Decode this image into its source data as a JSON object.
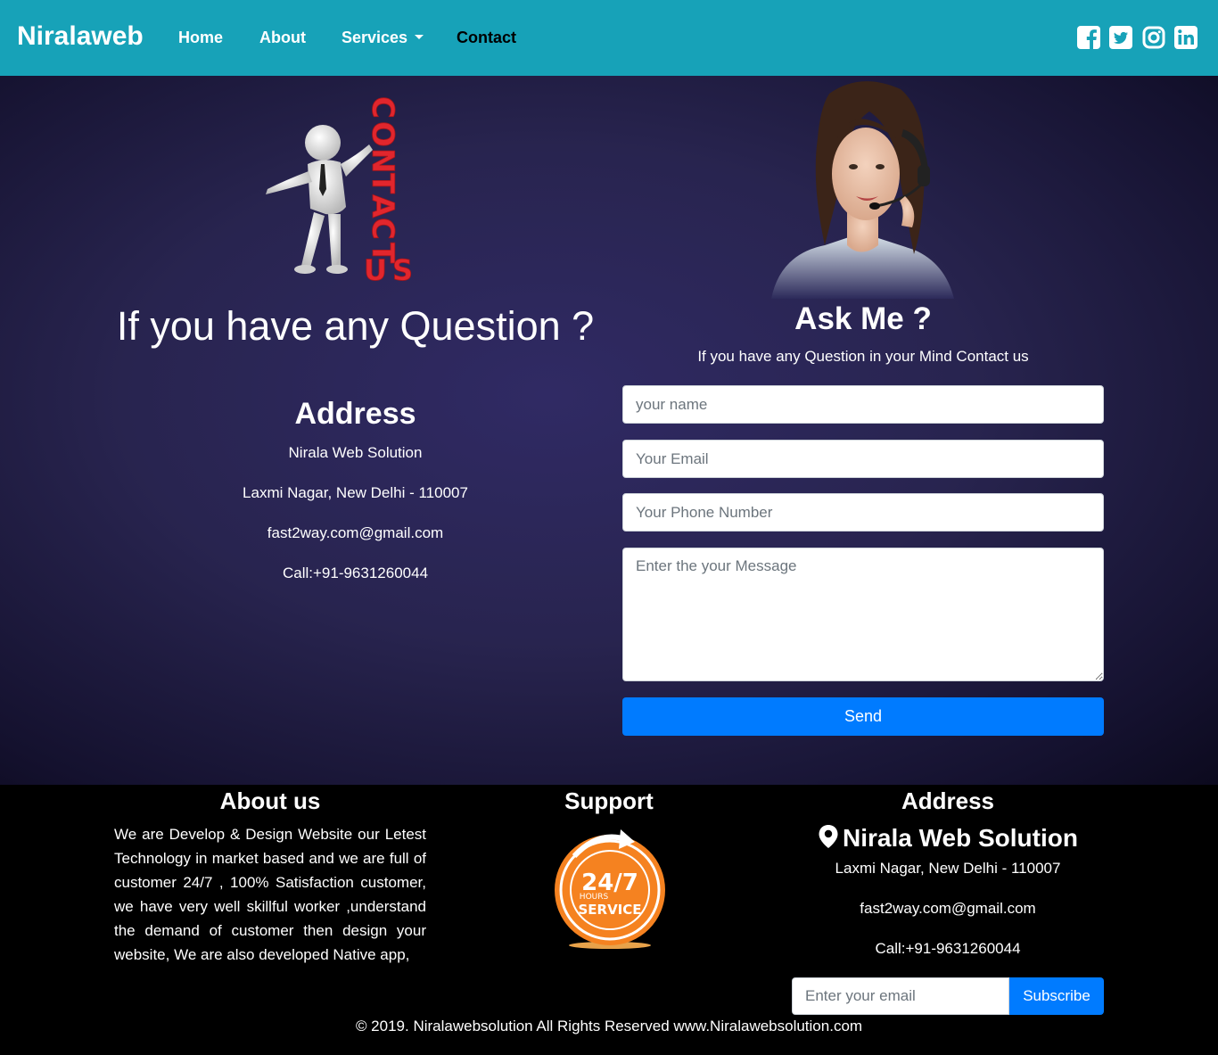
{
  "navbar": {
    "brand": "Niralaweb",
    "links": [
      "Home",
      "About",
      "Services",
      "Contact"
    ],
    "social_icons": [
      "facebook-icon",
      "twitter-icon",
      "instagram-icon",
      "linkedin-icon"
    ],
    "background": "#17a2b8"
  },
  "hero": {
    "illustration_text": "CONTACT US",
    "question_heading": "If you have any Question ?",
    "address_heading": "Address",
    "address_lines": [
      "Nirala Web Solution",
      "Laxmi Nagar, New Delhi - 110007",
      "fast2way.com@gmail.com",
      "Call:+91-9631260044"
    ]
  },
  "form": {
    "heading": "Ask Me ?",
    "subheading": "If you have any Question in your Mind Contact us",
    "name_placeholder": "your name",
    "email_placeholder": "Your Email",
    "phone_placeholder": "Your Phone Number",
    "message_placeholder": "Enter the your Message",
    "send_label": "Send",
    "button_color": "#007bff"
  },
  "footer": {
    "about_heading": "About us",
    "about_text": "We are Develop & Design Website our Letest Technology in market based and we are full of customer 24/7 , 100% Satisfaction customer, we have very well skillful worker ,understand the demand of customer then design your website, We are also developed Native app,",
    "support_heading": "Support",
    "support_badge": {
      "big": "24/7",
      "small": "HOURS",
      "label": "SERVICE"
    },
    "address_heading": "Address",
    "company": "Nirala Web Solution",
    "address_lines": [
      "Laxmi Nagar, New Delhi - 110007",
      "fast2way.com@gmail.com",
      "Call:+91-9631260044"
    ],
    "subscribe_placeholder": "Enter your email",
    "subscribe_label": "Subscribe",
    "copyright": "© 2019. Niralawebsolution All Rights Reserved www.Niralawebsolution.com"
  }
}
